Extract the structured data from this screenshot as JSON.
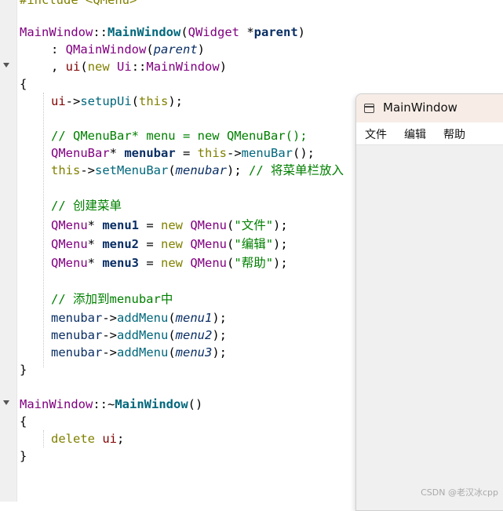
{
  "code": {
    "line0": "#include <QMenu>",
    "ctor_class": "MainWindow",
    "ctor_sep": "::",
    "ctor_name": "MainWindow",
    "ctor_open": "(",
    "ctor_param_type": "QWidget",
    "ctor_star": " *",
    "ctor_param": "parent",
    "ctor_close": ")",
    "init1_colon": ": ",
    "init1_base": "QMainWindow",
    "init1_open": "(",
    "init1_arg": "parent",
    "init1_close": ")",
    "init2_comma": ", ",
    "init2_member": "ui",
    "init2_open": "(",
    "init2_new": "new",
    "init2_sp": " ",
    "init2_ns": "Ui",
    "init2_sep": "::",
    "init2_type": "MainWindow",
    "init2_close": ")",
    "brace_open": "{",
    "setup_obj": "ui",
    "setup_arrow": "->",
    "setup_fn": "setupUi",
    "setup_open": "(",
    "setup_this": "this",
    "setup_close": ");",
    "comment_menu": "// QMenuBar* menu = new QMenuBar();",
    "mb_type": "QMenuBar",
    "mb_star": "* ",
    "mb_var": "menubar",
    "mb_eq": " = ",
    "mb_this": "this",
    "mb_arrow": "->",
    "mb_fn": "menuBar",
    "mb_close": "();",
    "smb_this": "this",
    "smb_arrow": "->",
    "smb_fn": "setMenuBar",
    "smb_open": "(",
    "smb_arg": "menubar",
    "smb_close": "); ",
    "smb_comment": "// 将菜单栏放入",
    "comment_create": "// 创建菜单",
    "m1_type": "QMenu",
    "m1_star": "* ",
    "m1_var": "menu1",
    "m1_eq": " = ",
    "m1_new": "new",
    "m1_ctor": " QMenu",
    "m1_open": "(",
    "m1_str": "\"文件\"",
    "m1_close": ");",
    "m2_type": "QMenu",
    "m2_star": "* ",
    "m2_var": "menu2",
    "m2_eq": " = ",
    "m2_new": "new",
    "m2_ctor": " QMenu",
    "m2_open": "(",
    "m2_str": "\"编辑\"",
    "m2_close": ");",
    "m3_type": "QMenu",
    "m3_star": "* ",
    "m3_var": "menu3",
    "m3_eq": " = ",
    "m3_new": "new",
    "m3_ctor": " QMenu",
    "m3_open": "(",
    "m3_str": "\"帮助\"",
    "m3_close": ");",
    "comment_add": "// 添加到menubar中",
    "a1_obj": "menubar",
    "a1_arrow": "->",
    "a1_fn": "addMenu",
    "a1_open": "(",
    "a1_arg": "menu1",
    "a1_close": ");",
    "a2_obj": "menubar",
    "a2_arrow": "->",
    "a2_fn": "addMenu",
    "a2_open": "(",
    "a2_arg": "menu2",
    "a2_close": ");",
    "a3_obj": "menubar",
    "a3_arrow": "->",
    "a3_fn": "addMenu",
    "a3_open": "(",
    "a3_arg": "menu3",
    "a3_close": ");",
    "brace_close": "}",
    "dtor_class": "MainWindow",
    "dtor_sep": "::~",
    "dtor_name": "MainWindow",
    "dtor_parens": "()",
    "dtor_brace_open": "{",
    "del_kw": "delete",
    "del_sp": " ",
    "del_var": "ui",
    "del_semi": ";",
    "dtor_brace_close": "}"
  },
  "window": {
    "title": "MainWindow",
    "icon": "window-icon",
    "menus": [
      "文件",
      "编辑",
      "帮助"
    ]
  },
  "watermark": "CSDN @老汉冰cpp",
  "colors": {
    "keyword": "#808000",
    "type": "#800080",
    "function": "#00677c",
    "comment": "#008000",
    "variable": "#092e64"
  }
}
